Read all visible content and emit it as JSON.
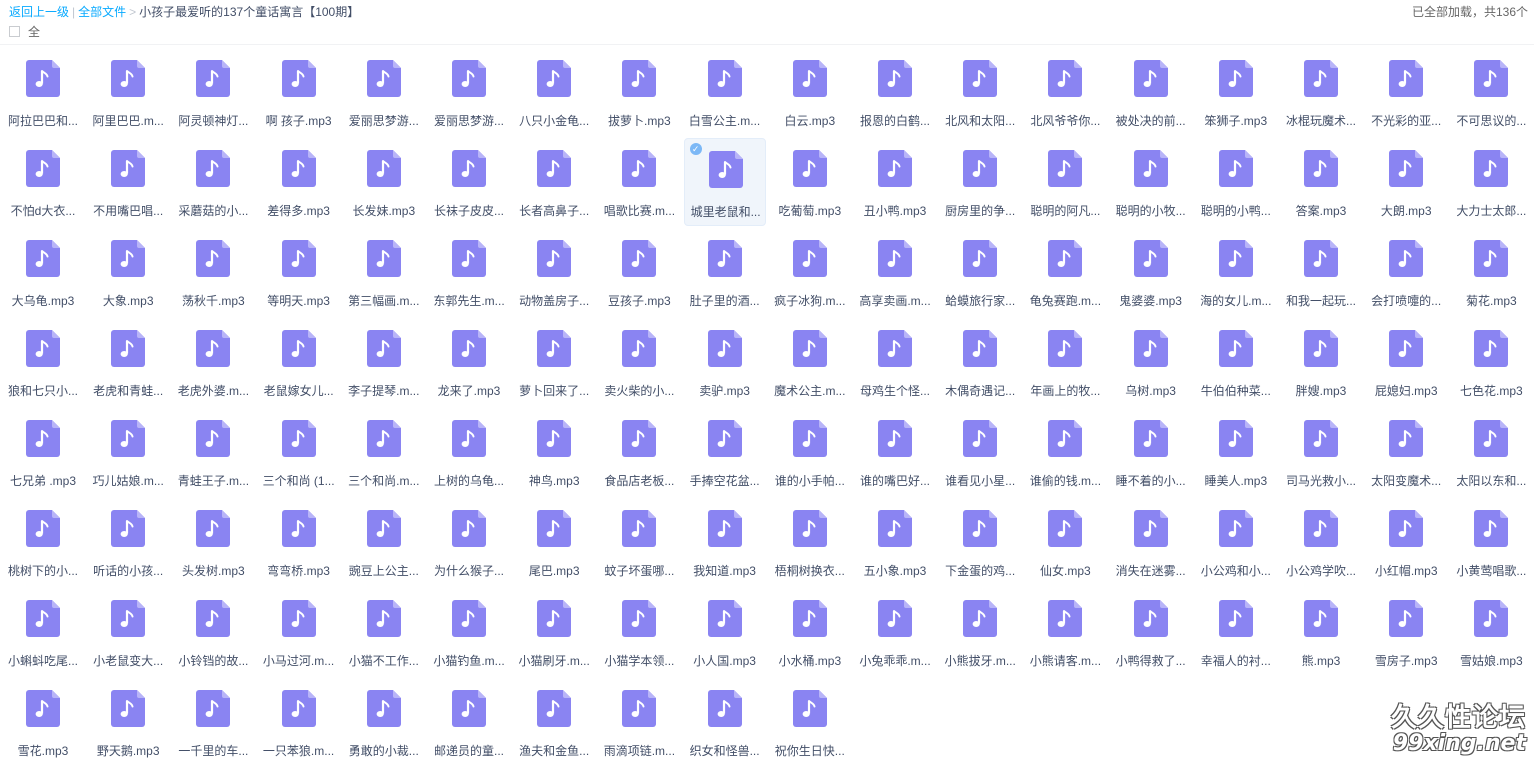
{
  "breadcrumb": {
    "back": "返回上一级",
    "separator": "|",
    "root": "全部文件",
    "chevron": ">",
    "current": "小孩子最爱听的137个童话寓言【100期】"
  },
  "status": "已全部加载，共136个",
  "select_all_label": "全",
  "icon": {
    "name": "music-file-icon",
    "color": "#8a84f2",
    "fold_color": "#b8b4f8"
  },
  "selected_index": 26,
  "files": [
    "阿拉巴巴和...",
    "阿里巴巴.m...",
    "阿灵顿神灯...",
    "啊 孩子.mp3",
    "爱丽思梦游...",
    "爱丽思梦游...",
    "八只小金龟...",
    "拔萝卜.mp3",
    "白雪公主.m...",
    "白云.mp3",
    "报恩的白鹤...",
    "北风和太阳...",
    "北风爷爷你...",
    "被处决的前...",
    "笨狮子.mp3",
    "冰棍玩魔术...",
    "不光彩的亚...",
    "不可思议的...",
    "不怕d大衣...",
    "不用嘴巴唱...",
    "采蘑菇的小...",
    "差得多.mp3",
    "长发妹.mp3",
    "长袜子皮皮...",
    "长者高鼻子...",
    "唱歌比赛.m...",
    "城里老鼠和...",
    "吃葡萄.mp3",
    "丑小鸭.mp3",
    "厨房里的争...",
    "聪明的阿凡...",
    "聪明的小牧...",
    "聪明的小鸭...",
    "答案.mp3",
    "大朗.mp3",
    "大力士太郎...",
    "大乌龟.mp3",
    "大象.mp3",
    "荡秋千.mp3",
    "等明天.mp3",
    "第三幅画.m...",
    "东郭先生.m...",
    "动物盖房子...",
    "豆孩子.mp3",
    "肚子里的酒...",
    "疯子冰狗.m...",
    "高享卖画.m...",
    "蛤蟆旅行家...",
    "龟兔赛跑.m...",
    "鬼婆婆.mp3",
    "海的女儿.m...",
    "和我一起玩...",
    "会打喷嚏的...",
    "菊花.mp3",
    "狼和七只小...",
    "老虎和青蛙...",
    "老虎外婆.m...",
    "老鼠嫁女儿...",
    "李子提琴.m...",
    "龙来了.mp3",
    "萝卜回来了...",
    "卖火柴的小...",
    "卖驴.mp3",
    "魔术公主.m...",
    "母鸡生个怪...",
    "木偶奇遇记...",
    "年画上的牧...",
    "乌树.mp3",
    "牛伯伯种菜...",
    "胖嫂.mp3",
    "屁媳妇.mp3",
    "七色花.mp3",
    "七兄弟 .mp3",
    "巧儿姑娘.m...",
    "青蛙王子.m...",
    "三个和尚 (1...",
    "三个和尚.m...",
    "上树的乌龟...",
    "神鸟.mp3",
    "食品店老板...",
    "手捧空花盆...",
    "谁的小手帕...",
    "谁的嘴巴好...",
    "谁看见小星...",
    "谁偷的钱.m...",
    "睡不着的小...",
    "睡美人.mp3",
    "司马光救小...",
    "太阳变魔术...",
    "太阳以东和...",
    "桃树下的小...",
    "听话的小孩...",
    "头发树.mp3",
    "弯弯桥.mp3",
    "豌豆上公主...",
    "为什么猴子...",
    "尾巴.mp3",
    "蚊子坏蛋哪...",
    "我知道.mp3",
    "梧桐树换衣...",
    "五小象.mp3",
    "下金蛋的鸡...",
    "仙女.mp3",
    "消失在迷雾...",
    "小公鸡和小...",
    "小公鸡学吹...",
    "小红帽.mp3",
    "小黄莺唱歌...",
    "小蝌蚪吃尾...",
    "小老鼠变大...",
    "小铃铛的故...",
    "小马过河.m...",
    "小猫不工作...",
    "小猫钓鱼.m...",
    "小猫刷牙.m...",
    "小猫学本领...",
    "小人国.mp3",
    "小水桶.mp3",
    "小兔乖乖.m...",
    "小熊拔牙.m...",
    "小熊请客.m...",
    "小鸭得救了...",
    "幸福人的衬...",
    "熊.mp3",
    "雪房子.mp3",
    "雪姑娘.mp3",
    "雪花.mp3",
    "野天鹅.mp3",
    "一千里的车...",
    "一只苯狼.m...",
    "勇敢的小裁...",
    "邮递员的童...",
    "渔夫和金鱼...",
    "雨滴项链.m...",
    "织女和怪兽...",
    "祝你生日快..."
  ],
  "watermark": {
    "line1": "久久性论坛",
    "line2": "99xing.net"
  }
}
